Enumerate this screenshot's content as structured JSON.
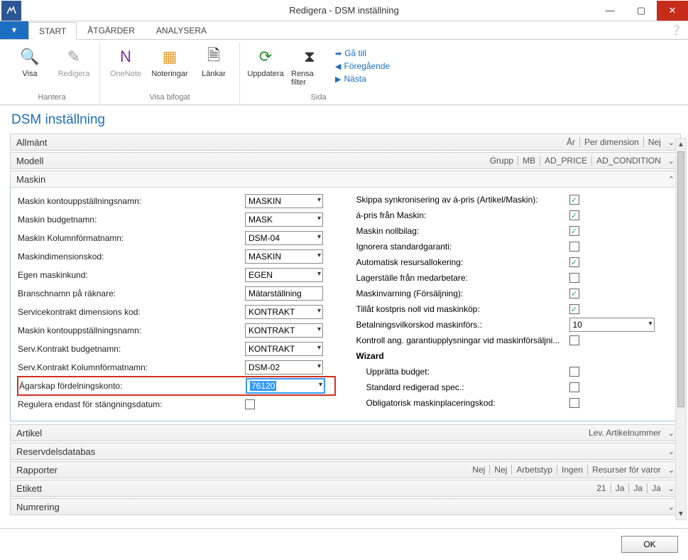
{
  "window": {
    "title": "Redigera - DSM inställning"
  },
  "tabs": {
    "file": "▾",
    "start": "START",
    "actions": "ÅTGÄRDER",
    "analyze": "ANALYSERA"
  },
  "ribbon": {
    "hantera": {
      "visa": "Visa",
      "redigera": "Redigera",
      "label": "Hantera"
    },
    "visaBifogat": {
      "onenote": "OneNote",
      "noteringar": "Noteringar",
      "lankar": "Länkar",
      "label": "Visa bifogat"
    },
    "sida": {
      "uppdatera": "Uppdatera",
      "rensa": "Rensa filter",
      "goto": "Gå till",
      "prev": "Föregående",
      "next": "Nästa",
      "label": "Sida"
    }
  },
  "pageTitle": "DSM inställning",
  "fasttabs": {
    "allmant": {
      "label": "Allmänt",
      "summary": [
        "År",
        "Per dimension",
        "Nej"
      ]
    },
    "modell": {
      "label": "Modell",
      "summary": [
        "Grupp",
        "MB",
        "AD_PRICE",
        "AD_CONDITION"
      ]
    },
    "maskin": {
      "label": "Maskin"
    },
    "artikel": {
      "label": "Artikel",
      "summary": [
        "Lev. Artikelnummer"
      ]
    },
    "reserv": {
      "label": "Reservdelsdatabas"
    },
    "rapporter": {
      "label": "Rapporter",
      "summary": [
        "Nej",
        "Nej",
        "Arbetstyp",
        "Ingen",
        "Resurser för varor"
      ]
    },
    "etikett": {
      "label": "Etikett",
      "summary": [
        "21",
        "Ja",
        "Ja",
        "Ja"
      ]
    },
    "numrering": {
      "label": "Numrering"
    }
  },
  "maskin": {
    "left": [
      {
        "label": "Maskin kontouppställningsnamn:",
        "value": "MASKIN",
        "combo": true
      },
      {
        "label": "Maskin budgetnamn:",
        "value": "MASK",
        "combo": true
      },
      {
        "label": "Maskin Kolumnförmatnamn:",
        "value": "DSM-04",
        "combo": true
      },
      {
        "label": "Maskindimensionskod:",
        "value": "MASKIN",
        "combo": true
      },
      {
        "label": "Egen maskinkund:",
        "value": "EGEN",
        "combo": true
      },
      {
        "label": "Branschnamn på räknare:",
        "value": "Mätarställning",
        "combo": false
      },
      {
        "label": "Servicekontrakt dimensions kod:",
        "value": "KONTRAKT",
        "combo": true
      },
      {
        "label": "Maskin kontouppställningsnamn:",
        "value": "KONTRAKT",
        "combo": true
      },
      {
        "label": "Serv.Kontrakt budgetnamn:",
        "value": "KONTRAKT",
        "combo": true
      },
      {
        "label": "Serv.Kontrakt Kolumnförmatnamn:",
        "value": "DSM-02",
        "combo": true
      },
      {
        "label": "Ägarskap fördelningskonto:",
        "value": "76120",
        "combo": true,
        "highlight": true,
        "selected": true
      },
      {
        "label": "Regulera endast för stängningsdatum:",
        "checkbox": true,
        "checked": false
      }
    ],
    "right": [
      {
        "label": "Skippa synkronisering av á-pris (Artikel/Maskin):",
        "checked": true
      },
      {
        "label": "á-pris från Maskin:",
        "checked": true
      },
      {
        "label": "Maskin nollbilag:",
        "checked": true
      },
      {
        "label": "Ignorera  standardgaranti:",
        "checked": false
      },
      {
        "label": "Automatisk resursallokering:",
        "checked": true
      },
      {
        "label": "Lagerställe från medarbetare:",
        "checked": false
      },
      {
        "label": "Maskinvarning (Försäljning):",
        "checked": true
      },
      {
        "label": "Tillåt kostpris noll vid maskinköp:",
        "checked": true
      },
      {
        "label": "Betalningsvilkorskod maskinförs.:",
        "combo": true,
        "value": "10"
      },
      {
        "label": "Kontroll ang. garantiupplysningar vid maskinförsäljni...",
        "checked": false
      }
    ],
    "wizardHeader": "Wizard",
    "wizard": [
      {
        "label": "Upprätta budget:",
        "checked": false
      },
      {
        "label": "Standard redigerad spec.:",
        "checked": false
      },
      {
        "label": "Obligatorisk maskinplaceringskod:",
        "checked": false
      }
    ]
  },
  "ok": "OK"
}
